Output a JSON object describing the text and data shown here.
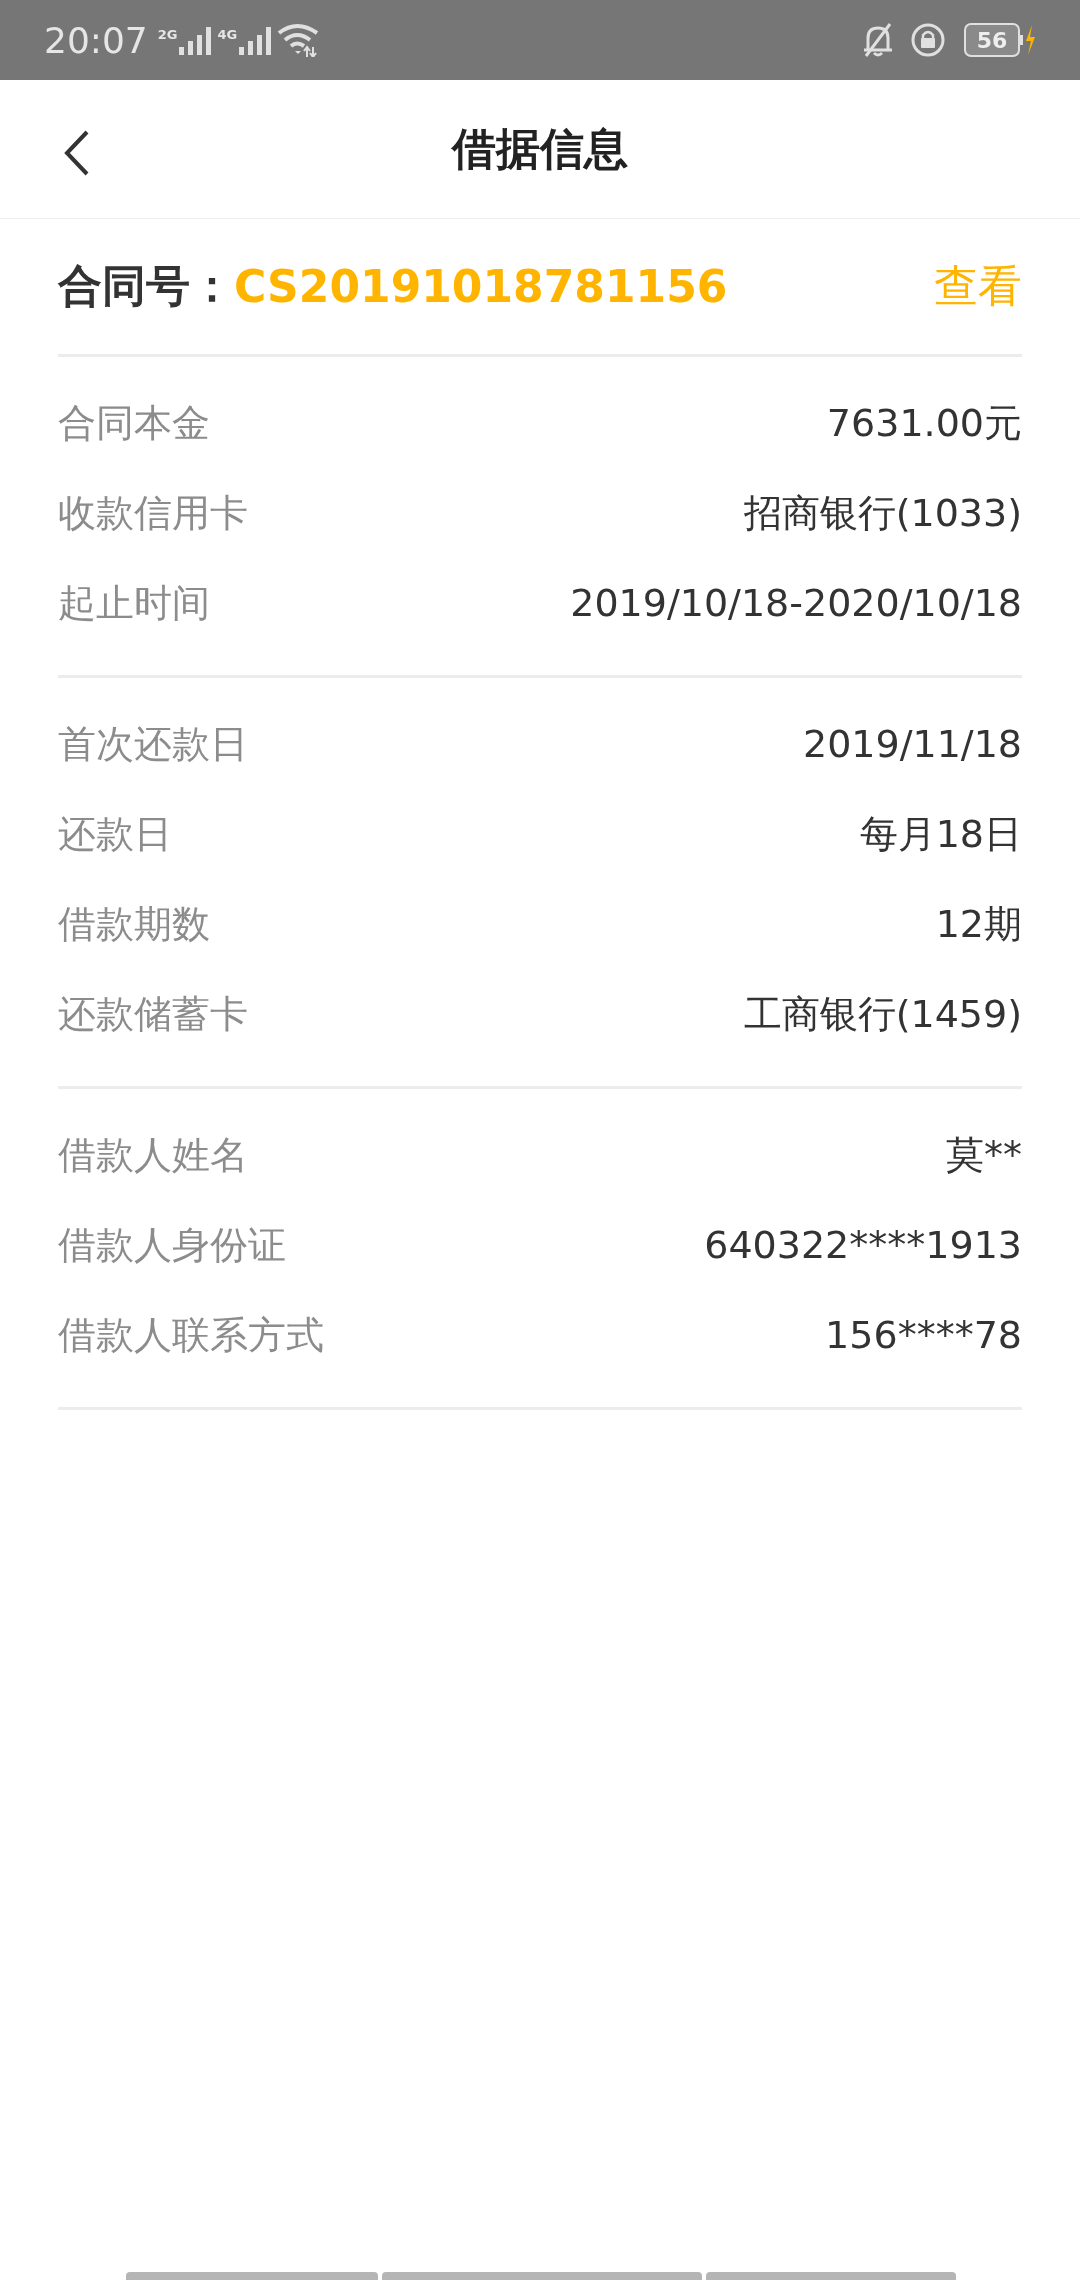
{
  "status_bar": {
    "time": "20:07",
    "signals": [
      "2G",
      "4G"
    ],
    "battery": "56"
  },
  "header": {
    "title": "借据信息"
  },
  "contract": {
    "label": "合同号：",
    "number": "CS20191018781156",
    "link": "查看"
  },
  "groups": [
    {
      "rows": [
        {
          "label": "合同本金",
          "value": "7631.00元"
        },
        {
          "label": "收款信用卡",
          "value": "招商银行(1033)"
        },
        {
          "label": "起止时间",
          "value": "2019/10/18-2020/10/18"
        }
      ]
    },
    {
      "rows": [
        {
          "label": "首次还款日",
          "value": "2019/11/18"
        },
        {
          "label": "还款日",
          "value": "每月18日"
        },
        {
          "label": "借款期数",
          "value": "12期"
        },
        {
          "label": "还款储蓄卡",
          "value": "工商银行(1459)"
        }
      ]
    },
    {
      "rows": [
        {
          "label": "借款人姓名",
          "value": "莫**"
        },
        {
          "label": "借款人身份证",
          "value": "640322****1913"
        },
        {
          "label": "借款人联系方式",
          "value": "156****78"
        }
      ]
    }
  ]
}
